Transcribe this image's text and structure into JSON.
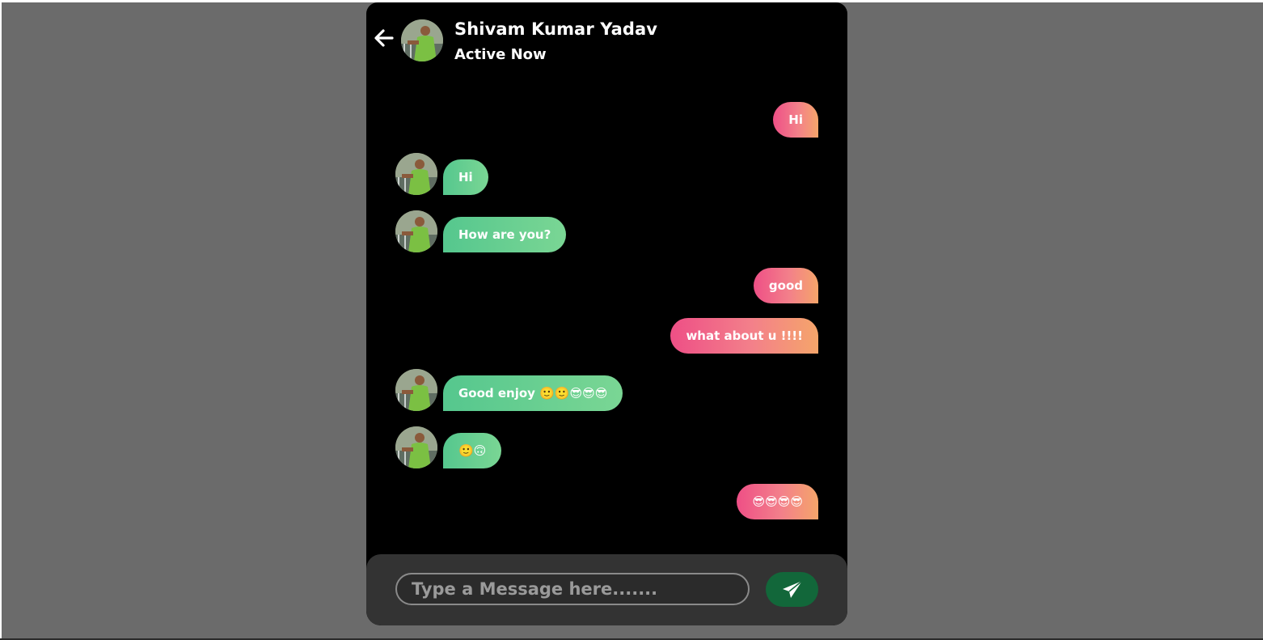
{
  "header": {
    "back_icon": "arrow-left-icon",
    "name": "Shivam Kumar Yadav",
    "status": "Active Now"
  },
  "messages": [
    {
      "direction": "out",
      "text": "Hi"
    },
    {
      "direction": "in",
      "text": "Hi"
    },
    {
      "direction": "in",
      "text": "How are you?"
    },
    {
      "direction": "out",
      "text": "good"
    },
    {
      "direction": "out",
      "text": "what about u !!!!"
    },
    {
      "direction": "in",
      "text": "Good enjoy 🙂🙂😎😎😎"
    },
    {
      "direction": "in",
      "text": "🙂🙃"
    },
    {
      "direction": "out",
      "text": "😎😎😎😎"
    }
  ],
  "composer": {
    "placeholder": "Type a Message here.......",
    "send_icon": "paper-plane-icon"
  },
  "colors": {
    "background": "#6b6b6b",
    "chat_background": "#000000",
    "outgoing_gradient": [
      "#ee4f86",
      "#f5a56a"
    ],
    "incoming_gradient": [
      "#55c78e",
      "#7ad694"
    ],
    "send_button": "#12673a",
    "composer_bar": "#333333"
  }
}
